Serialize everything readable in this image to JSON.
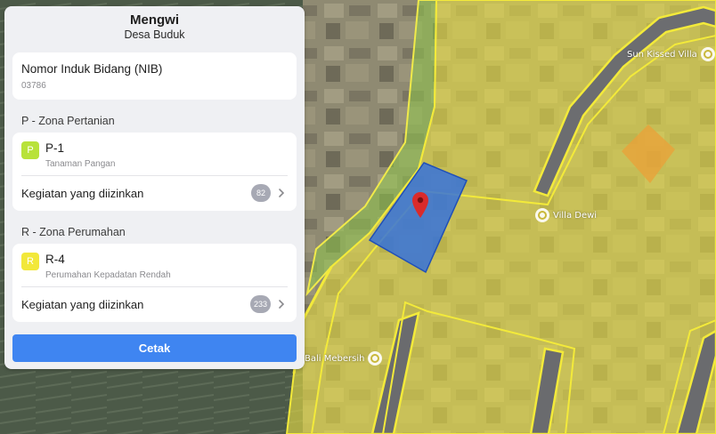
{
  "colors": {
    "primary": "#3f85f1",
    "zone_yellow": "#d9d24a",
    "zone_green": "#8fc64a",
    "selected_parcel": "#2f6fe0",
    "pin": "#d92b2b",
    "badge_p": "#b8e23a",
    "badge_r": "#f2e83a"
  },
  "panel": {
    "title": "Mengwi",
    "subtitle": "Desa Buduk",
    "nib": {
      "label": "Nomor Induk Bidang (NIB)",
      "value": "03786"
    },
    "zones": [
      {
        "section_title": "P - Zona Pertanian",
        "badge": "P",
        "badge_color": "#b8e23a",
        "code": "P-1",
        "description": "Tanaman Pangan",
        "activities_label": "Kegiatan yang diizinkan",
        "activities_count": "82"
      },
      {
        "section_title": "R - Zona Perumahan",
        "badge": "R",
        "badge_color": "#f2e83a",
        "code": "R-4",
        "description": "Perumahan Kepadatan Rendah",
        "activities_label": "Kegiatan yang diizinkan",
        "activities_count": "233"
      }
    ],
    "print_label": "Cetak"
  },
  "map": {
    "pois": [
      {
        "name": "Sun Kissed Villa",
        "icon": "poi-icon"
      },
      {
        "name": "Villa Dewi",
        "icon": "poi-icon"
      },
      {
        "name": "Bali Mebersih",
        "icon": "poi-icon"
      }
    ]
  }
}
